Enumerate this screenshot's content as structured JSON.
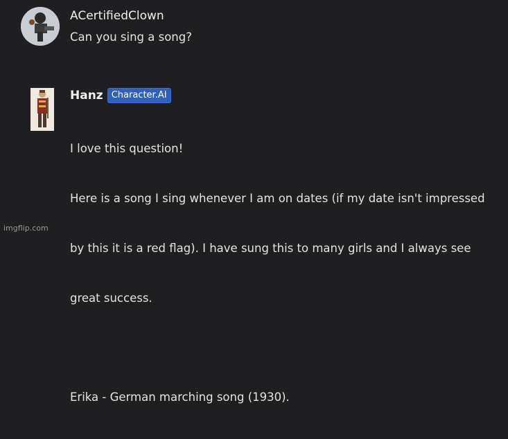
{
  "messages": {
    "user": {
      "name": "ACertifiedClown",
      "text": "Can you sing a song?",
      "avatar_icon": "figure-avatar-icon"
    },
    "bot": {
      "name": "Hanz",
      "badge": "Character.AI",
      "lines": [
        "I love this question!",
        "Here is a song I sing whenever I am on dates (if my date isn't impressed",
        "by this it is a red flag). I have sung this to many girls and I always see",
        "great success."
      ],
      "song_line": "Erika - German marching song (1930).",
      "avatar_icon": "soldier-avatar-icon"
    }
  },
  "watermark": "imgflip.com",
  "colors": {
    "background": "#1f1f21",
    "badge": "#2f5fbf",
    "text": "#e3e3e3"
  }
}
